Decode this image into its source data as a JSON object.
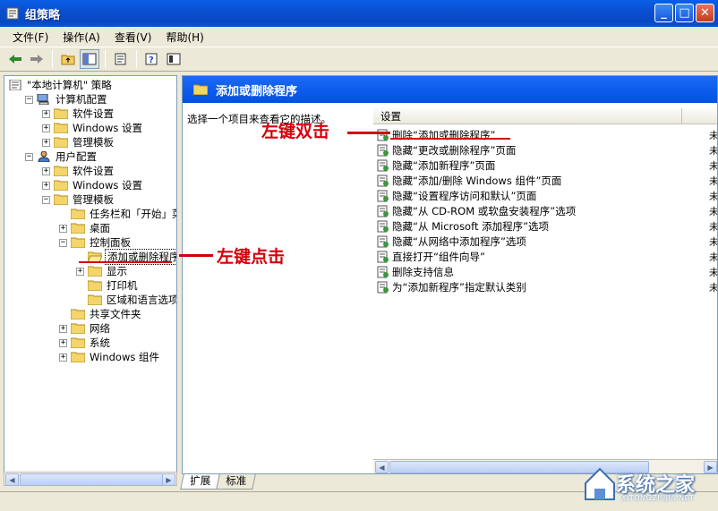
{
  "window": {
    "title": "组策略"
  },
  "menu": [
    "文件(F)",
    "操作(A)",
    "查看(V)",
    "帮助(H)"
  ],
  "tree": [
    {
      "label": "\"本地计算机\" 策略",
      "depth": 0,
      "expander": "",
      "icon": "policy-icon"
    },
    {
      "label": "计算机配置",
      "depth": 1,
      "expander": "−",
      "icon": "computer-icon"
    },
    {
      "label": "软件设置",
      "depth": 2,
      "expander": "+",
      "icon": "folder-icon"
    },
    {
      "label": "Windows 设置",
      "depth": 2,
      "expander": "+",
      "icon": "folder-icon"
    },
    {
      "label": "管理模板",
      "depth": 2,
      "expander": "+",
      "icon": "folder-icon"
    },
    {
      "label": "用户配置",
      "depth": 1,
      "expander": "−",
      "icon": "user-icon"
    },
    {
      "label": "软件设置",
      "depth": 2,
      "expander": "+",
      "icon": "folder-icon"
    },
    {
      "label": "Windows 设置",
      "depth": 2,
      "expander": "+",
      "icon": "folder-icon"
    },
    {
      "label": "管理模板",
      "depth": 2,
      "expander": "−",
      "icon": "folder-icon"
    },
    {
      "label": "任务栏和「开始」菜",
      "depth": 3,
      "expander": "",
      "icon": "folder-icon"
    },
    {
      "label": "桌面",
      "depth": 3,
      "expander": "+",
      "icon": "folder-icon"
    },
    {
      "label": "控制面板",
      "depth": 3,
      "expander": "−",
      "icon": "folder-icon"
    },
    {
      "label": "添加或删除程序",
      "depth": 4,
      "expander": "",
      "icon": "folder-open-icon",
      "selected": true
    },
    {
      "label": "显示",
      "depth": 4,
      "expander": "+",
      "icon": "folder-icon"
    },
    {
      "label": "打印机",
      "depth": 4,
      "expander": "",
      "icon": "folder-icon"
    },
    {
      "label": "区域和语言选项",
      "depth": 4,
      "expander": "",
      "icon": "folder-icon"
    },
    {
      "label": "共享文件夹",
      "depth": 3,
      "expander": "",
      "icon": "folder-icon"
    },
    {
      "label": "网络",
      "depth": 3,
      "expander": "+",
      "icon": "folder-icon"
    },
    {
      "label": "系统",
      "depth": 3,
      "expander": "+",
      "icon": "folder-icon"
    },
    {
      "label": "Windows 组件",
      "depth": 3,
      "expander": "+",
      "icon": "folder-icon"
    }
  ],
  "right": {
    "header_title": "添加或删除程序",
    "description": "选择一个项目来查看它的描述。",
    "column_header": "设置",
    "rows": [
      "删除“添加或删除程序”",
      "隐藏“更改或删除程序”页面",
      "隐藏“添加新程序”页面",
      "隐藏“添加/删除 Windows 组件”页面",
      "隐藏“设置程序访问和默认”页面",
      "隐藏“从 CD-ROM 或软盘安装程序”选项",
      "隐藏“从 Microsoft 添加程序”选项",
      "隐藏“从网络中添加程序”选项",
      "直接打开“组件向导”",
      "删除支持信息",
      "为“添加新程序”指定默认类别"
    ],
    "row_state": "未"
  },
  "tabs": [
    "扩展",
    "标准"
  ],
  "annotations": {
    "double_click": "左键双击",
    "left_click": "左键点击"
  },
  "watermark": {
    "title": "系统之家",
    "sub": "XITONGZHIJIA.NET"
  },
  "colors": {
    "accent_red": "#d4000a",
    "header_blue": "#0050e2"
  }
}
